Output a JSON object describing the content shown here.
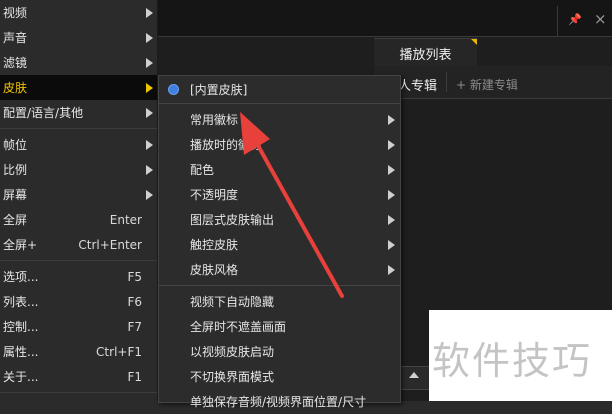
{
  "app": {
    "playlist_tab": "播放列表",
    "subtab_album": "人专辑",
    "subtab_new": "+ 新建专辑"
  },
  "main_menu": {
    "items": [
      {
        "label": "视频",
        "shortcut": "",
        "submenu": true
      },
      {
        "label": "声音",
        "shortcut": "",
        "submenu": true
      },
      {
        "label": "滤镜",
        "shortcut": "",
        "submenu": true
      },
      {
        "label": "皮肤",
        "shortcut": "",
        "submenu": true,
        "active": true
      },
      {
        "label": "配置/语言/其他",
        "shortcut": "",
        "submenu": true
      },
      {
        "label": "帧位",
        "shortcut": "",
        "submenu": true
      },
      {
        "label": "比例",
        "shortcut": "",
        "submenu": true
      },
      {
        "label": "屏幕",
        "shortcut": "",
        "submenu": true
      },
      {
        "label": "全屏",
        "shortcut": "Enter",
        "submenu": false
      },
      {
        "label": "全屏+",
        "shortcut": "Ctrl+Enter",
        "submenu": false
      },
      {
        "label": "选项...",
        "shortcut": "F5",
        "submenu": false
      },
      {
        "label": "列表...",
        "shortcut": "F6",
        "submenu": false
      },
      {
        "label": "控制...",
        "shortcut": "F7",
        "submenu": false
      },
      {
        "label": "属性...",
        "shortcut": "Ctrl+F1",
        "submenu": false
      },
      {
        "label": "关于...",
        "shortcut": "F1",
        "submenu": false
      }
    ]
  },
  "skin_submenu": {
    "items": [
      {
        "label": "[内置皮肤]",
        "selected": true,
        "submenu": false
      },
      {
        "label": "常用徽标",
        "submenu": true
      },
      {
        "label": "播放时的徽标",
        "submenu": true
      },
      {
        "label": "配色",
        "submenu": true
      },
      {
        "label": "不透明度",
        "submenu": true
      },
      {
        "label": "图层式皮肤输出",
        "submenu": true
      },
      {
        "label": "触控皮肤",
        "submenu": true
      },
      {
        "label": "皮肤风格",
        "submenu": true
      },
      {
        "label": "视频下自动隐藏",
        "submenu": false
      },
      {
        "label": "全屏时不遮盖画面",
        "submenu": false
      },
      {
        "label": "以视频皮肤启动",
        "submenu": false
      },
      {
        "label": "不切换界面模式",
        "submenu": false
      },
      {
        "label": "单独保存音频/视频界面位置/尺寸",
        "submenu": false
      }
    ]
  },
  "watermark": {
    "text": "软件技巧"
  },
  "colors": {
    "menu_bg": "#2b2b2b",
    "active_text": "#f0c300",
    "radio": "#3f7fe0",
    "annotation_arrow": "#e8413c"
  }
}
